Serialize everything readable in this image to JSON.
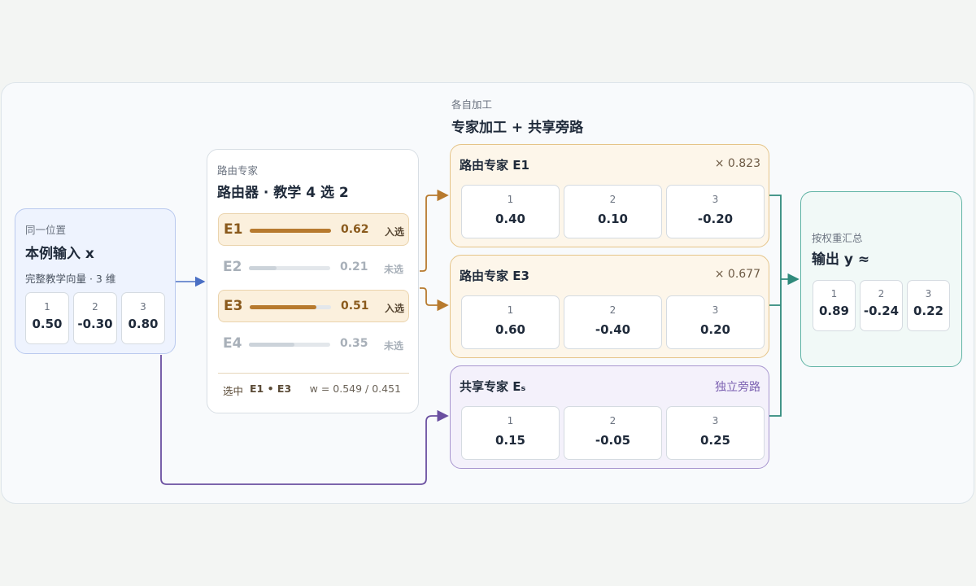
{
  "input": {
    "kicker": "同一位置",
    "title": "本例输入 x",
    "subtitle": "完整教学向量 · 3 维",
    "cells": [
      {
        "idx": "1",
        "val": "0.50"
      },
      {
        "idx": "2",
        "val": "-0.30"
      },
      {
        "idx": "3",
        "val": "0.80"
      }
    ]
  },
  "router": {
    "kicker": "路由专家",
    "title": "路由器 · 教学 4 选 2",
    "rows": [
      {
        "id": "E1",
        "score": "0.62",
        "state": "入选",
        "selected": true,
        "level": 0.62
      },
      {
        "id": "E2",
        "score": "0.21",
        "state": "未选",
        "selected": false,
        "level": 0.21
      },
      {
        "id": "E3",
        "score": "0.51",
        "state": "入选",
        "selected": true,
        "level": 0.51
      },
      {
        "id": "E4",
        "score": "0.35",
        "state": "未选",
        "selected": false,
        "level": 0.35
      }
    ],
    "footer_label": "选中",
    "footer_selected": "E1 • E3",
    "footer_weights": "w = 0.549 / 0.451"
  },
  "section": {
    "kicker": "各自加工",
    "title": "专家加工 + 共享旁路"
  },
  "experts": [
    {
      "name": "路由专家 E1",
      "weight": "× 0.823",
      "cells": [
        {
          "idx": "1",
          "val": "0.40"
        },
        {
          "idx": "2",
          "val": "0.10"
        },
        {
          "idx": "3",
          "val": "-0.20"
        }
      ]
    },
    {
      "name": "路由专家 E3",
      "weight": "× 0.677",
      "cells": [
        {
          "idx": "1",
          "val": "0.60"
        },
        {
          "idx": "2",
          "val": "-0.40"
        },
        {
          "idx": "3",
          "val": "0.20"
        }
      ]
    },
    {
      "name": "共享专家 Eₛ",
      "weight": "独立旁路",
      "cells": [
        {
          "idx": "1",
          "val": "0.15"
        },
        {
          "idx": "2",
          "val": "-0.05"
        },
        {
          "idx": "3",
          "val": "0.25"
        }
      ]
    }
  ],
  "output": {
    "kicker": "按权重汇总",
    "title": "输出 y ≈",
    "cells": [
      {
        "idx": "1",
        "val": "0.89"
      },
      {
        "idx": "2",
        "val": "-0.24"
      },
      {
        "idx": "3",
        "val": "0.22"
      }
    ]
  },
  "colors": {
    "input_wire": "#4a6fc4",
    "routed_wire": "#b77a2e",
    "shared_wire": "#6a4fa0",
    "output_wire": "#2f8a7c"
  }
}
